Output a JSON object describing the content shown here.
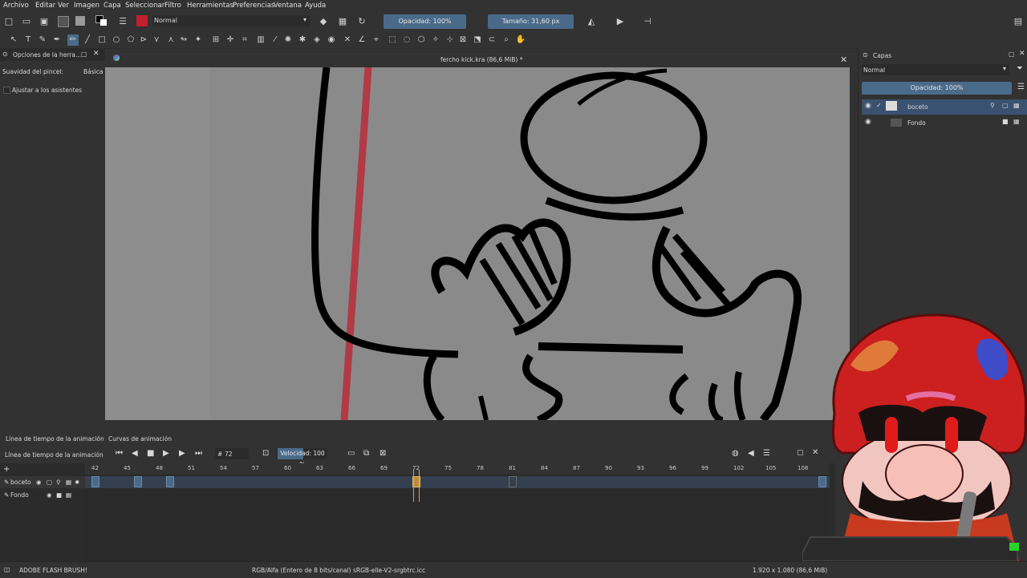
{
  "menu": [
    "Archivo",
    "Editar",
    "Ver",
    "Imagen",
    "Capa",
    "Seleccionar",
    "Filtro",
    "Herramientas",
    "Preferencias",
    "Ventana",
    "Ayuda"
  ],
  "toolbar": {
    "blend_mode": "Normal",
    "opacity": "Opacidad: 100%",
    "size": "Tamaño: 31,60 px"
  },
  "tool_options": {
    "title": "Opciones de la herra...",
    "smoothing_label": "Suavidad del pincel:",
    "smoothing_value": "Básica",
    "assistants_label": "Ajustar a los asistentes"
  },
  "document": {
    "title": "fercho kick.kra (86,6 MiB) *"
  },
  "layers": {
    "title": "Capas",
    "blend_mode": "Normal",
    "opacity": "Opacidad:  100%",
    "items": [
      {
        "name": "boceto"
      },
      {
        "name": "Fondo"
      }
    ]
  },
  "timeline": {
    "tabs": [
      "Línea de tiempo de la animación",
      "Curvas de animación"
    ],
    "title": "Línea de tiempo de la animación",
    "frame": "72",
    "speed": "Velocidad: 100 %",
    "frames": [
      "42",
      "45",
      "48",
      "51",
      "54",
      "57",
      "60",
      "63",
      "66",
      "69",
      "72",
      "75",
      "78",
      "81",
      "84",
      "87",
      "90",
      "93",
      "96",
      "99",
      "102",
      "105",
      "108"
    ],
    "layers": [
      "boceto",
      "Fondo"
    ]
  },
  "status": {
    "brush": "ADOBE FLASH BRUSH!",
    "color": "RGB/Alfa (Entero de 8 bits/canal)  sRGB-elle-V2-srgbtrc.icc",
    "dims": "1.920 x 1.080 (86,6 MiB)"
  },
  "colors": {
    "accent": "#4a6a8a",
    "panel": "#323232",
    "canvas": "#8a8a8a"
  }
}
